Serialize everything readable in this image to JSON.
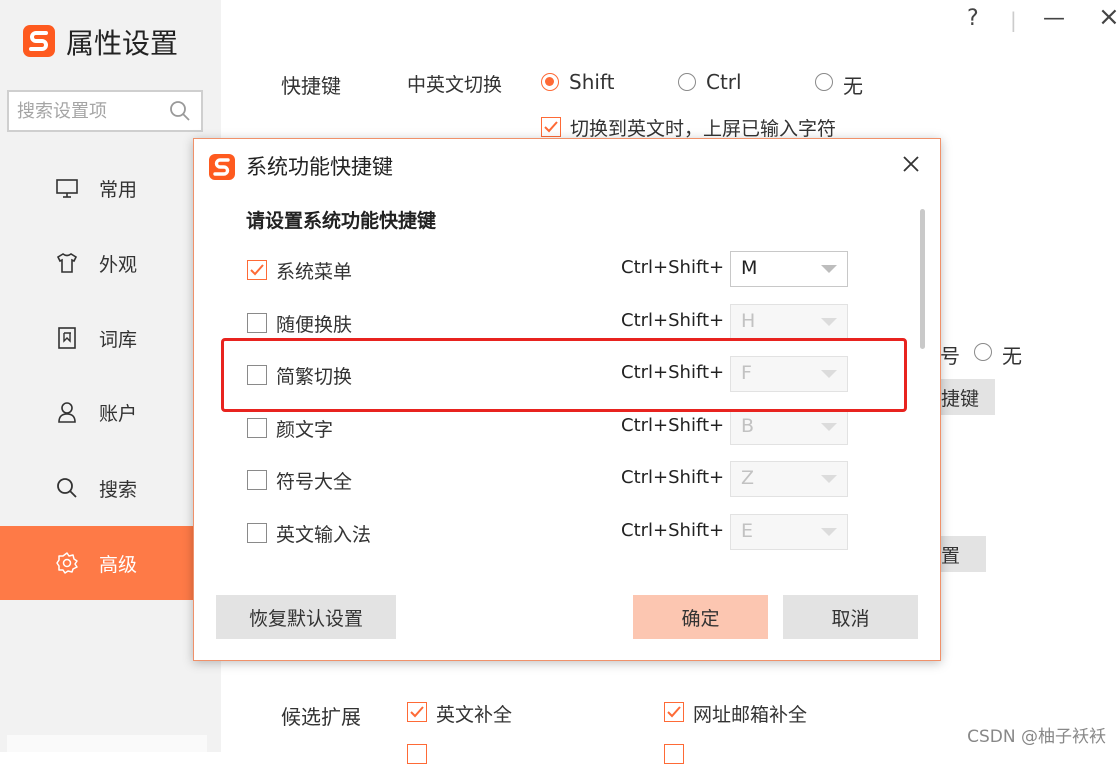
{
  "app": {
    "title": "属性设置",
    "search_placeholder": "搜索设置项"
  },
  "window_controls": {
    "help": "?",
    "separator": "|",
    "minimize": "—",
    "close": "×"
  },
  "sidebar": {
    "items": [
      {
        "label": "常用",
        "icon": "monitor-icon",
        "active": false
      },
      {
        "label": "外观",
        "icon": "shirt-icon",
        "active": false
      },
      {
        "label": "词库",
        "icon": "book-icon",
        "active": false
      },
      {
        "label": "账户",
        "icon": "user-icon",
        "active": false
      },
      {
        "label": "搜索",
        "icon": "search-icon",
        "active": false
      },
      {
        "label": "高级",
        "icon": "gear-icon",
        "active": true
      }
    ]
  },
  "background": {
    "shortcut_label": "快捷键",
    "cn_en_switch_label": "中英文切换",
    "switch_options": [
      "Shift",
      "Ctrl",
      "无"
    ],
    "switch_selected": "Shift",
    "commit_checkbox_label": "切换到英文时，上屏已输入字符",
    "partial_right_label_1": "号",
    "partial_right_radio": "无",
    "partial_button_1": "捷键",
    "partial_button_2": "置",
    "candidate_label": "候选扩展",
    "candidate_items": [
      "英文补全",
      "网址邮箱补全"
    ]
  },
  "dialog": {
    "title": "系统功能快捷键",
    "heading": "请设置系统功能快捷键",
    "modifier": "Ctrl+Shift+",
    "rows": [
      {
        "label": "系统菜单",
        "checked": true,
        "key": "M"
      },
      {
        "label": "随便换肤",
        "checked": false,
        "key": "H"
      },
      {
        "label": "简繁切换",
        "checked": false,
        "key": "F"
      },
      {
        "label": "颜文字",
        "checked": false,
        "key": "B"
      },
      {
        "label": "符号大全",
        "checked": false,
        "key": "Z"
      },
      {
        "label": "英文输入法",
        "checked": false,
        "key": "E"
      }
    ],
    "buttons": {
      "restore": "恢复默认设置",
      "ok": "确定",
      "cancel": "取消"
    }
  },
  "colors": {
    "accent": "#fe7a47",
    "ok_button": "#fcc6b1",
    "highlight": "#e8231f"
  },
  "watermark": "CSDN @柚子袄袄"
}
